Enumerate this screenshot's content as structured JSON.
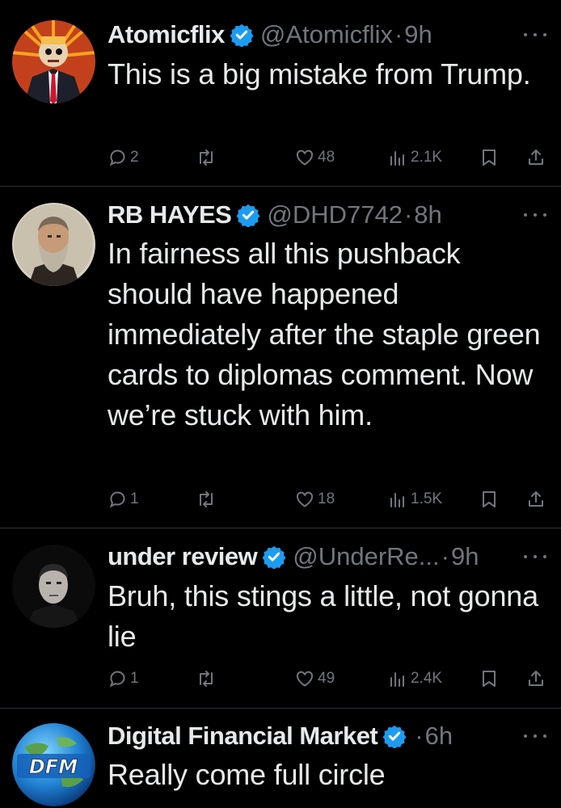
{
  "colors": {
    "background": "#000000",
    "text": "#e7e9ea",
    "muted": "#71767b",
    "verified": "#1d9bf0",
    "divider": "#2f3336"
  },
  "tweets": [
    {
      "name": "Atomicflix",
      "handle": "@Atomicflix",
      "separator": "·",
      "time": "9h",
      "text": "This is a big mistake from Trump.",
      "replies": "2",
      "retweets": "",
      "likes": "48",
      "views": "2.1K"
    },
    {
      "name": "RB HAYES",
      "handle": "@DHD7742",
      "separator": "·",
      "time": "8h",
      "text": "In fairness all this pushback should have happened immediately after the staple green cards to diplomas comment. Now we’re stuck with him.",
      "replies": "1",
      "retweets": "",
      "likes": "18",
      "views": "1.5K"
    },
    {
      "name": "under review",
      "handle": "@UnderRe...",
      "separator": "·",
      "time": "9h",
      "text": "Bruh, this stings a little, not gonna lie",
      "replies": "1",
      "retweets": "",
      "likes": "49",
      "views": "2.4K"
    },
    {
      "name": "Digital Financial Market",
      "handle": "",
      "separator": "·",
      "time": "6h",
      "text": "Really come full circle",
      "avatar_text": "DFM"
    }
  ],
  "icons": {
    "verified": "verified-badge-icon",
    "more": "more-options-icon",
    "reply": "reply-icon",
    "retweet": "retweet-icon",
    "like": "like-icon",
    "views": "views-icon",
    "bookmark": "bookmark-icon",
    "share": "share-icon"
  }
}
